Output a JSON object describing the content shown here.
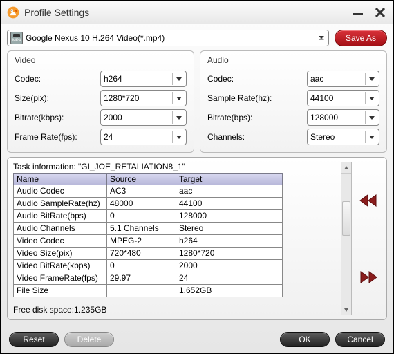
{
  "window": {
    "title": "Profile Settings"
  },
  "profile": {
    "selected": "Google Nexus 10 H.264 Video(*.mp4)",
    "save_as_label": "Save As"
  },
  "video": {
    "section_title": "Video",
    "codec_label": "Codec:",
    "codec_value": "h264",
    "size_label": "Size(pix):",
    "size_value": "1280*720",
    "bitrate_label": "Bitrate(kbps):",
    "bitrate_value": "2000",
    "framerate_label": "Frame Rate(fps):",
    "framerate_value": "24"
  },
  "audio": {
    "section_title": "Audio",
    "codec_label": "Codec:",
    "codec_value": "aac",
    "samplerate_label": "Sample Rate(hz):",
    "samplerate_value": "44100",
    "bitrate_label": "Bitrate(bps):",
    "bitrate_value": "128000",
    "channels_label": "Channels:",
    "channels_value": "Stereo"
  },
  "task": {
    "title": "Task information: \"GI_JOE_RETALIATION8_1\"",
    "headers": {
      "name": "Name",
      "source": "Source",
      "target": "Target"
    },
    "rows": [
      {
        "name": "Audio Codec",
        "source": "AC3",
        "target": "aac"
      },
      {
        "name": "Audio SampleRate(hz)",
        "source": "48000",
        "target": "44100"
      },
      {
        "name": "Audio BitRate(bps)",
        "source": "0",
        "target": "128000"
      },
      {
        "name": "Audio Channels",
        "source": "5.1 Channels",
        "target": "Stereo"
      },
      {
        "name": "Video Codec",
        "source": "MPEG-2",
        "target": "h264"
      },
      {
        "name": "Video Size(pix)",
        "source": "720*480",
        "target": "1280*720"
      },
      {
        "name": "Video BitRate(kbps)",
        "source": "0",
        "target": "2000"
      },
      {
        "name": "Video FrameRate(fps)",
        "source": "29.97",
        "target": "24"
      },
      {
        "name": "File Size",
        "source": "",
        "target": "1.652GB"
      }
    ],
    "free_disk": "Free disk space:1.235GB"
  },
  "footer": {
    "reset": "Reset",
    "delete": "Delete",
    "ok": "OK",
    "cancel": "Cancel"
  },
  "icons": {
    "profile_icon": "mp4-icon"
  }
}
